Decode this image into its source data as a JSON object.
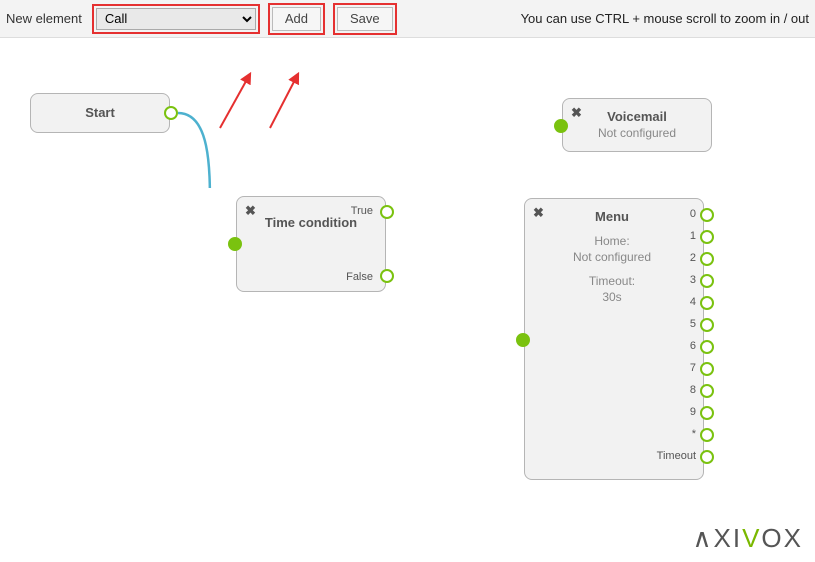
{
  "toolbar": {
    "label": "New element",
    "select_value": "Call",
    "add_label": "Add",
    "save_label": "Save",
    "hint": "You can use CTRL + mouse scroll to zoom in / out"
  },
  "nodes": {
    "start": {
      "title": "Start"
    },
    "time": {
      "title": "Time condition",
      "out_true": "True",
      "out_false": "False"
    },
    "voicemail": {
      "title": "Voicemail",
      "sub": "Not configured"
    },
    "menu": {
      "title": "Menu",
      "home_label": "Home:",
      "home_value": "Not configured",
      "timeout_label": "Timeout:",
      "timeout_value": "30s",
      "outputs": [
        "0",
        "1",
        "2",
        "3",
        "4",
        "5",
        "6",
        "7",
        "8",
        "9",
        "*",
        "Timeout"
      ]
    }
  },
  "brand": "∧XIVOX"
}
